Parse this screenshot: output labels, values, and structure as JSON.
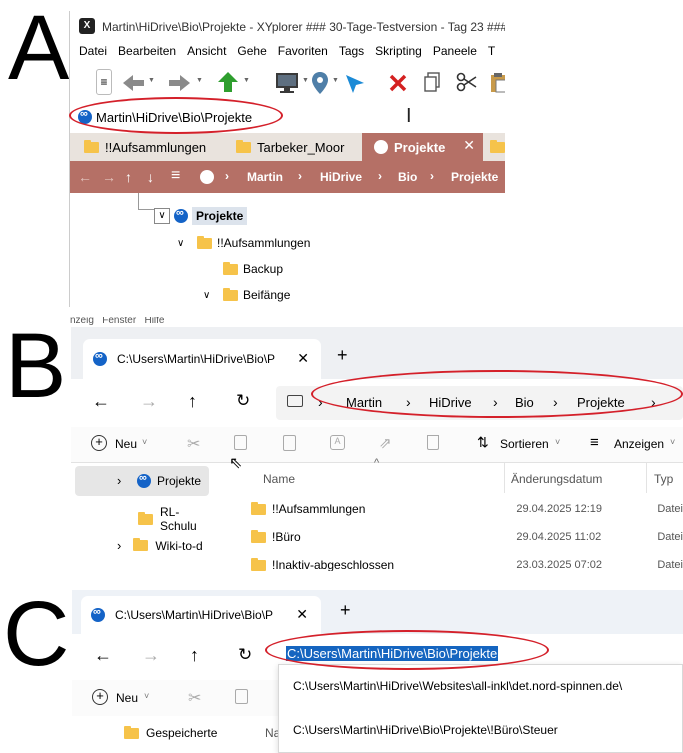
{
  "letters": {
    "a": "A",
    "b": "B",
    "c": "C"
  },
  "panel_a": {
    "window_title": "Martin\\HiDrive\\Bio\\Projekte - XYplorer ### 30-Tage-Testversion - Tag 23 ###",
    "menu": [
      "Datei",
      "Bearbeiten",
      "Ansicht",
      "Gehe",
      "Favoriten",
      "Tags",
      "Skripting",
      "Paneele",
      "T"
    ],
    "address": "Martin\\HiDrive\\Bio\\Projekte",
    "tabs": [
      {
        "label": "!!Aufsammlungen"
      },
      {
        "label": "Tarbeker_Moor"
      },
      {
        "label": "Projekte",
        "active": true
      }
    ],
    "breadcrumb": [
      "Martin",
      "HiDrive",
      "Bio",
      "Projekte"
    ],
    "tree": {
      "root": "Projekte",
      "items": [
        "!!Aufsammlungen",
        "Backup",
        "Beifänge"
      ]
    },
    "accent": "#b57066"
  },
  "panel_b": {
    "top_menu_fragment": "nzeig   Fenster   Hilfe",
    "tab_title": "C:\\Users\\Martin\\HiDrive\\Bio\\P",
    "breadcrumb": [
      "Martin",
      "HiDrive",
      "Bio",
      "Projekte"
    ],
    "new_label": "Neu",
    "sort_label": "Sortieren",
    "view_label": "Anzeigen",
    "nav_items": [
      "Projekte",
      "RL-Schulu",
      "Wiki-to-d"
    ],
    "columns": {
      "name": "Name",
      "date": "Änderungsdatum",
      "type": "Typ"
    },
    "files": [
      {
        "name": "!!Aufsammlungen",
        "date": "29.04.2025 12:19",
        "type": "Datei"
      },
      {
        "name": "!Büro",
        "date": "29.04.2025 11:02",
        "type": "Datei"
      },
      {
        "name": "!Inaktiv-abgeschlossen",
        "date": "23.03.2025 07:02",
        "type": "Datei"
      }
    ]
  },
  "panel_c": {
    "tab_title": "C:\\Users\\Martin\\HiDrive\\Bio\\P",
    "address": "C:\\Users\\Martin\\HiDrive\\Bio\\Projekte",
    "new_label": "Neu",
    "nav_item": "Gespeicherte",
    "column_fragment": "Na",
    "suggestions": [
      "C:\\Users\\Martin\\HiDrive\\Websites\\all-inkl\\det.nord-spinnen.de\\",
      "C:\\Users\\Martin\\HiDrive\\Bio\\Projekte\\!Büro\\Steuer"
    ]
  },
  "colors": {
    "annotation": "#d4202a",
    "selection": "#1565c0",
    "hidrive": "#1463c7",
    "folder": "#f6c34a"
  }
}
